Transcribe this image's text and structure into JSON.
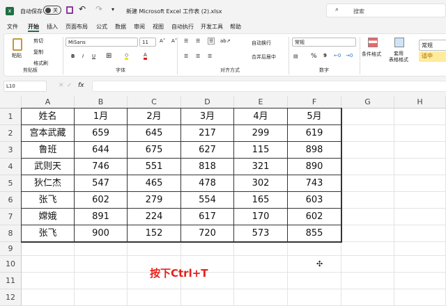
{
  "titlebar": {
    "autosave_label": "自动保存",
    "autosave_state": "关",
    "filename": "新建 Microsoft Excel 工作表 (2).xlsx",
    "search_placeholder": "搜索"
  },
  "menu_tabs": [
    "文件",
    "开始",
    "插入",
    "页面布局",
    "公式",
    "数据",
    "审阅",
    "视图",
    "自动执行",
    "开发工具",
    "帮助"
  ],
  "ribbon": {
    "clipboard": {
      "paste": "粘贴",
      "cut": "剪切",
      "copy": "复制",
      "format_painter": "格式刷",
      "label": "剪贴板"
    },
    "font": {
      "name": "MiSans",
      "size": "11",
      "bold": "B",
      "italic": "I",
      "underline": "U",
      "label": "字体"
    },
    "alignment": {
      "wrap": "自动换行",
      "merge": "合并后居中",
      "label": "对齐方式"
    },
    "number": {
      "format": "常规",
      "percent": "%",
      "comma": "9",
      "label": "数字"
    },
    "styles": {
      "conditional": "条件格式",
      "table_format": "套用\n表格格式",
      "style_normal": "常规",
      "style_neutral": "适中"
    }
  },
  "formula_bar": {
    "name_box": "L10",
    "fx": "fx",
    "value": ""
  },
  "columns": [
    "A",
    "B",
    "C",
    "D",
    "E",
    "F",
    "G",
    "H"
  ],
  "rows": [
    "1",
    "2",
    "3",
    "4",
    "5",
    "6",
    "7",
    "8",
    "9",
    "10",
    "11",
    "12"
  ],
  "table": {
    "header": [
      "姓名",
      "1月",
      "2月",
      "3月",
      "4月",
      "5月"
    ],
    "rows": [
      [
        "宫本武藏",
        "659",
        "645",
        "217",
        "299",
        "619"
      ],
      [
        "鲁班",
        "644",
        "675",
        "627",
        "115",
        "898"
      ],
      [
        "武则天",
        "746",
        "551",
        "818",
        "321",
        "890"
      ],
      [
        "狄仁杰",
        "547",
        "465",
        "478",
        "302",
        "743"
      ],
      [
        "张飞",
        "602",
        "279",
        "554",
        "165",
        "603"
      ],
      [
        "嫦娥",
        "891",
        "224",
        "617",
        "170",
        "602"
      ],
      [
        "张飞",
        "900",
        "152",
        "720",
        "573",
        "855"
      ]
    ]
  },
  "annotation": {
    "text": "按下Ctrl+T",
    "color": "#e8201a"
  }
}
